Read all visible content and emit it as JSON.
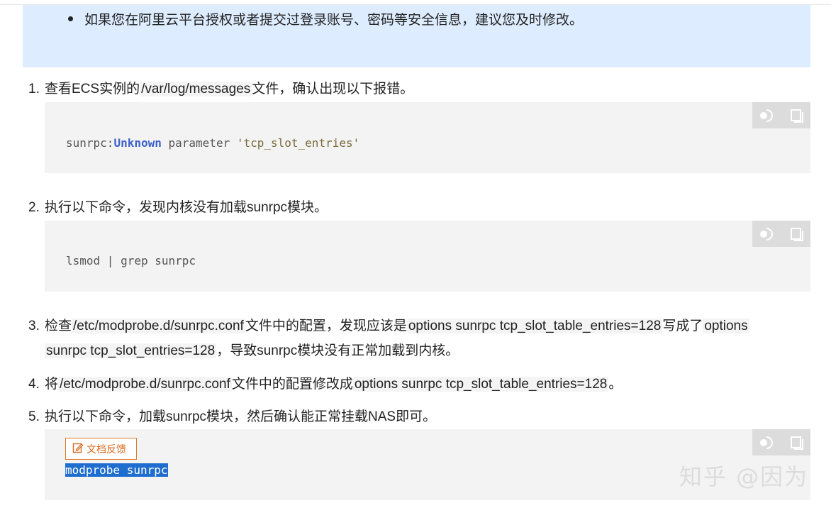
{
  "notice": {
    "bullet_text": "如果您在阿里云平台授权或者提交过登录账号、密码等安全信息，建议您及时修改。"
  },
  "steps": [
    {
      "num": "1.",
      "pre": "查看ECS实例的",
      "code": "/var/log/messages",
      "post": "文件，确认出现以下报错。"
    },
    {
      "num": "2.",
      "text": "执行以下命令，发现内核没有加载sunrpc模块。"
    },
    {
      "num": "3.",
      "pre": "检查",
      "code1": "/etc/modprobe.d/sunrpc.conf",
      "mid1": "文件中的配置，发现应该是",
      "code2": "options sunrpc tcp_slot_table_entries=128",
      "mid2": "写成了",
      "code3a": "options",
      "code3b": "sunrpc tcp_slot_entries=128",
      "post": "，导致sunrpc模块没有正常加载到内核。"
    },
    {
      "num": "4.",
      "pre": "将",
      "code1": "/etc/modprobe.d/sunrpc.conf",
      "mid": "文件中的配置修改成",
      "code2": "options sunrpc tcp_slot_table_entries=128",
      "post": "。"
    },
    {
      "num": "5.",
      "text": "执行以下命令，加载sunrpc模块，然后确认能正常挂载NAS即可。"
    }
  ],
  "code_blocks": {
    "c1": {
      "a": "sunrpc:",
      "kw": "Unknown",
      "b": " parameter ",
      "str": "'tcp_slot_entries'"
    },
    "c2": {
      "text": "lsmod | grep sunrpc"
    },
    "c3": {
      "text": "modprobe sunrpc"
    }
  },
  "feedback_label": "文档反馈",
  "watermark": "知乎 @因为",
  "icons": [
    "run-icon",
    "copy-icon",
    "edit-icon"
  ],
  "colors": {
    "notice_bg": "#ddecfe",
    "code_bg": "#f3f3f3",
    "keyword": "#3d62c9",
    "selection": "#1f6ecf",
    "feedback": "#e2792a"
  }
}
